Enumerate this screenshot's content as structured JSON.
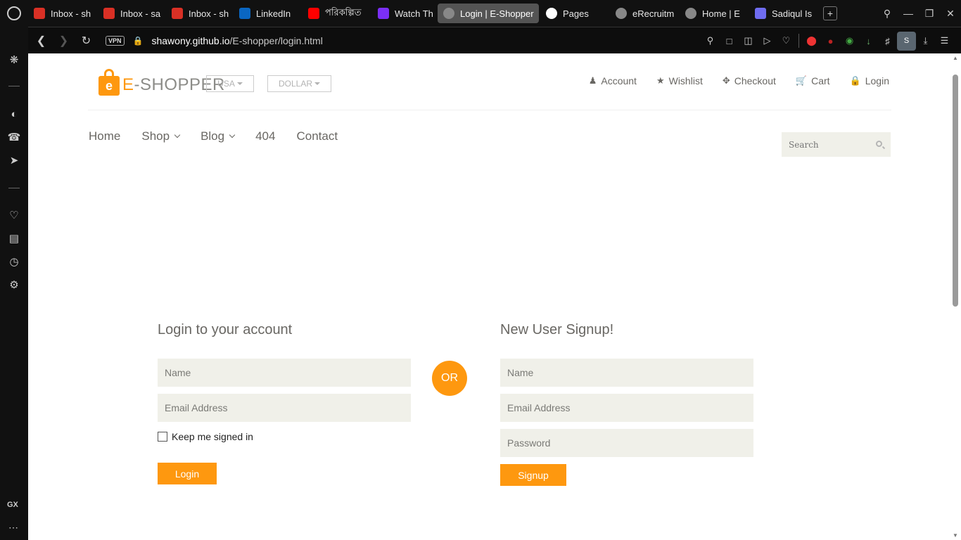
{
  "browser": {
    "tabs": [
      {
        "title": "Inbox - sh",
        "icon": "gmail-icon",
        "color": "#d93025"
      },
      {
        "title": "Inbox - sa",
        "icon": "gmail-icon",
        "color": "#d93025"
      },
      {
        "title": "Inbox - sh",
        "icon": "gmail-icon",
        "color": "#d93025"
      },
      {
        "title": "LinkedIn",
        "icon": "linkedin-icon",
        "color": "#0a66c2"
      },
      {
        "title": "পরিকল্পিত",
        "icon": "youtube-icon",
        "color": "#ff0000"
      },
      {
        "title": "Watch Th",
        "icon": "play-icon",
        "color": "#7b2ff7"
      },
      {
        "title": "Login | E-Shopper",
        "icon": "globe-icon",
        "color": "#888888"
      },
      {
        "title": "Pages",
        "icon": "github-icon",
        "color": "#ffffff"
      },
      {
        "title": "eRecruitm",
        "icon": "globe-icon",
        "color": "#888888"
      },
      {
        "title": "Home | E",
        "icon": "globe-icon",
        "color": "#888888"
      },
      {
        "title": "Sadiqul Is",
        "icon": "messenger-icon",
        "color": "#6f6cf0"
      }
    ],
    "active_tab": 6,
    "vpn_label": "VPN",
    "url_host": "shawony.github.io",
    "url_path": "/E-shopper/login.html",
    "profile_initial": "S",
    "sidebar_gx": "GX"
  },
  "header": {
    "logo_prefix": "E",
    "logo_text": "-SHOPPER",
    "bag_letter": "e",
    "country": "USA",
    "currency": "DOLLAR",
    "links": [
      {
        "label": "Account",
        "icon": "user-icon"
      },
      {
        "label": "Wishlist",
        "icon": "star-icon"
      },
      {
        "label": "Checkout",
        "icon": "crosshairs-icon"
      },
      {
        "label": "Cart",
        "icon": "cart-icon"
      },
      {
        "label": "Login",
        "icon": "lock-icon"
      }
    ]
  },
  "nav": {
    "home": "Home",
    "shop": "Shop",
    "blog": "Blog",
    "notfound": "404",
    "contact": "Contact",
    "search_placeholder": "Search"
  },
  "login": {
    "title": "Login to your account",
    "name_placeholder": "Name",
    "email_placeholder": "Email Address",
    "keep_signed_in": "Keep me signed in",
    "button": "Login"
  },
  "or_label": "OR",
  "signup": {
    "title": "New User Signup!",
    "name_placeholder": "Name",
    "email_placeholder": "Email Address",
    "password_placeholder": "Password",
    "button": "Signup"
  },
  "colors": {
    "accent": "#fe980f",
    "field_bg": "#f0f0e9",
    "text": "#696763"
  }
}
